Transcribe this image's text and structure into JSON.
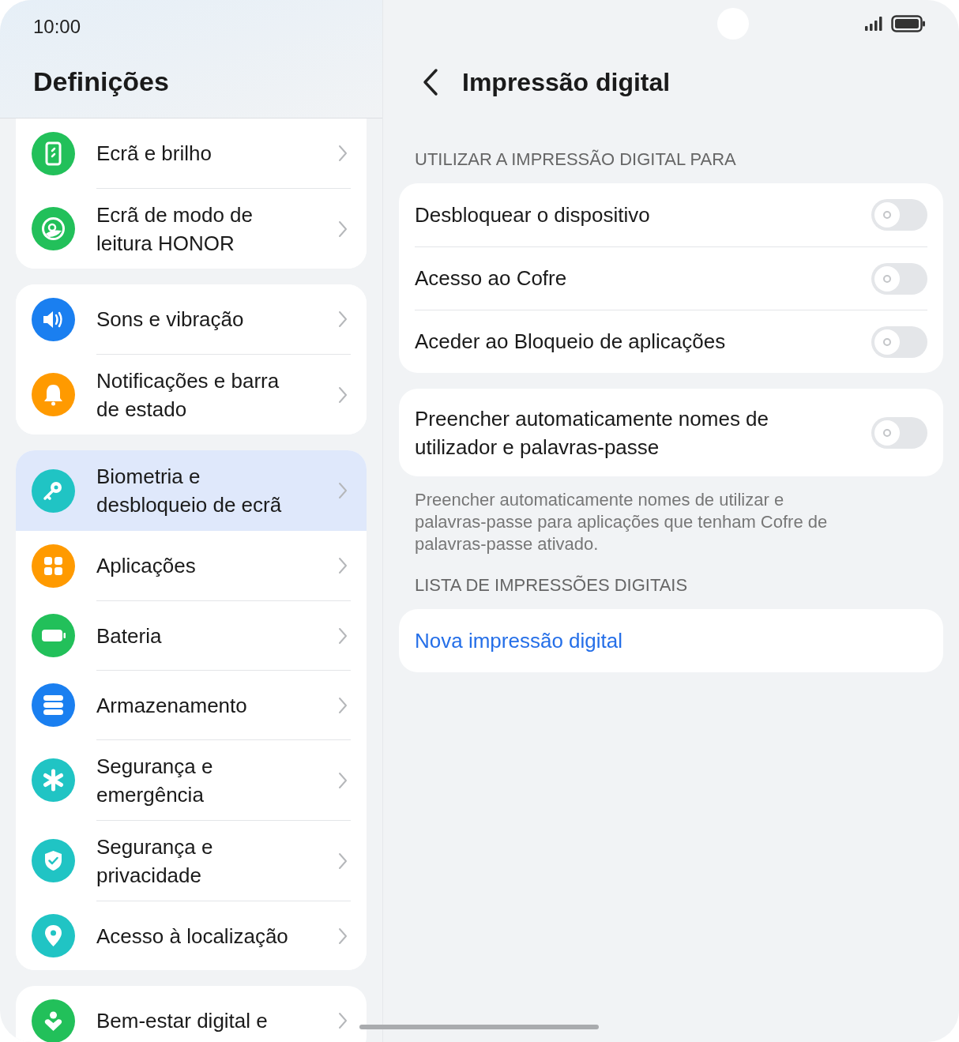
{
  "status_bar": {
    "time": "10:00"
  },
  "sidebar": {
    "title": "Definições",
    "groups": [
      {
        "items": [
          {
            "label": "Ecrã e brilho",
            "color": "#22c05a",
            "selected": false
          },
          {
            "label": "Ecrã de modo de leitura HONOR",
            "color": "#22c05a",
            "selected": false
          }
        ]
      },
      {
        "items": [
          {
            "label": "Sons e vibração",
            "color": "#1a7ff0",
            "selected": false
          },
          {
            "label": "Notificações e barra de estado",
            "color": "#ff9a00",
            "selected": false
          }
        ]
      },
      {
        "items": [
          {
            "label": "Biometria e desbloqueio de ecrã",
            "color": "#20c4c4",
            "selected": true
          },
          {
            "label": "Aplicações",
            "color": "#ff9a00",
            "selected": false
          },
          {
            "label": "Bateria",
            "color": "#22c05a",
            "selected": false
          },
          {
            "label": "Armazenamento",
            "color": "#1a7ff0",
            "selected": false
          },
          {
            "label": "Segurança e emergência",
            "color": "#20c4c4",
            "selected": false
          },
          {
            "label": "Segurança e privacidade",
            "color": "#20c4c4",
            "selected": false
          },
          {
            "label": "Acesso à localização",
            "color": "#20c4c4",
            "selected": false
          }
        ]
      },
      {
        "items": [
          {
            "label": "Bem-estar digital e",
            "color": "#22c05a",
            "selected": false
          }
        ]
      }
    ]
  },
  "detail": {
    "title": "Impressão digital",
    "section_1_header": "UTILIZAR A IMPRESSÃO DIGITAL PARA",
    "toggles": [
      {
        "label": "Desbloquear o dispositivo",
        "on": false
      },
      {
        "label": "Acesso ao Cofre",
        "on": false
      },
      {
        "label": "Aceder ao Bloqueio de aplicações",
        "on": false
      }
    ],
    "autofill": {
      "label": "Preencher automaticamente nomes de utilizador e palavras-passe",
      "on": false
    },
    "autofill_note": "Preencher automaticamente nomes de utilizar e palavras-passe para aplicações que tenham Cofre de palavras-passe ativado.",
    "section_2_header": "LISTA DE IMPRESSÕES DIGITAIS",
    "new_fingerprint_link": "Nova impressão digital"
  }
}
